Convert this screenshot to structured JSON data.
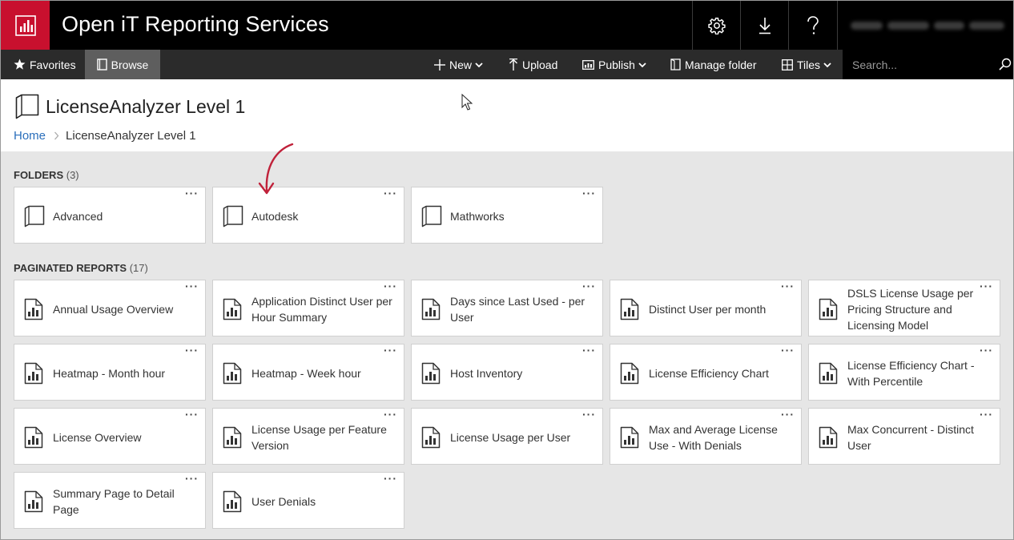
{
  "header": {
    "app_title": "Open iT Reporting Services",
    "icons": [
      "settings-icon",
      "download-icon",
      "help-icon"
    ]
  },
  "commandbar": {
    "favorites": "Favorites",
    "browse": "Browse",
    "new": "New",
    "upload": "Upload",
    "publish": "Publish",
    "manage_folder": "Manage folder",
    "tiles": "Tiles",
    "search_placeholder": "Search..."
  },
  "page": {
    "title": "LicenseAnalyzer Level 1",
    "breadcrumb_home": "Home",
    "breadcrumb_current": "LicenseAnalyzer Level 1"
  },
  "folders": {
    "heading": "FOLDERS",
    "count": "(3)",
    "items": [
      "Advanced",
      "Autodesk",
      "Mathworks"
    ]
  },
  "reports": {
    "heading": "PAGINATED REPORTS",
    "count": "(17)",
    "items": [
      "Annual Usage Overview",
      "Application Distinct User per Hour Summary",
      "Days since Last Used - per User",
      "Distinct User per month",
      "DSLS License Usage per Pricing Structure and Licensing Model",
      "Heatmap - Month hour",
      "Heatmap - Week hour",
      "Host Inventory",
      "License Efficiency Chart",
      "License Efficiency Chart - With Percentile",
      "License Overview",
      "License Usage per Feature Version",
      "License Usage per User",
      "Max and Average License Use - With Denials",
      "Max Concurrent - Distinct User",
      "Summary Page to Detail Page",
      "User Denials"
    ]
  },
  "tile_menu_label": "···",
  "colors": {
    "brand_red": "#c8102e",
    "header_bg": "#000000",
    "cmdbar_bg": "#2b2b2b",
    "link_blue": "#2a6ebb",
    "annotation_red": "#c0213a"
  }
}
